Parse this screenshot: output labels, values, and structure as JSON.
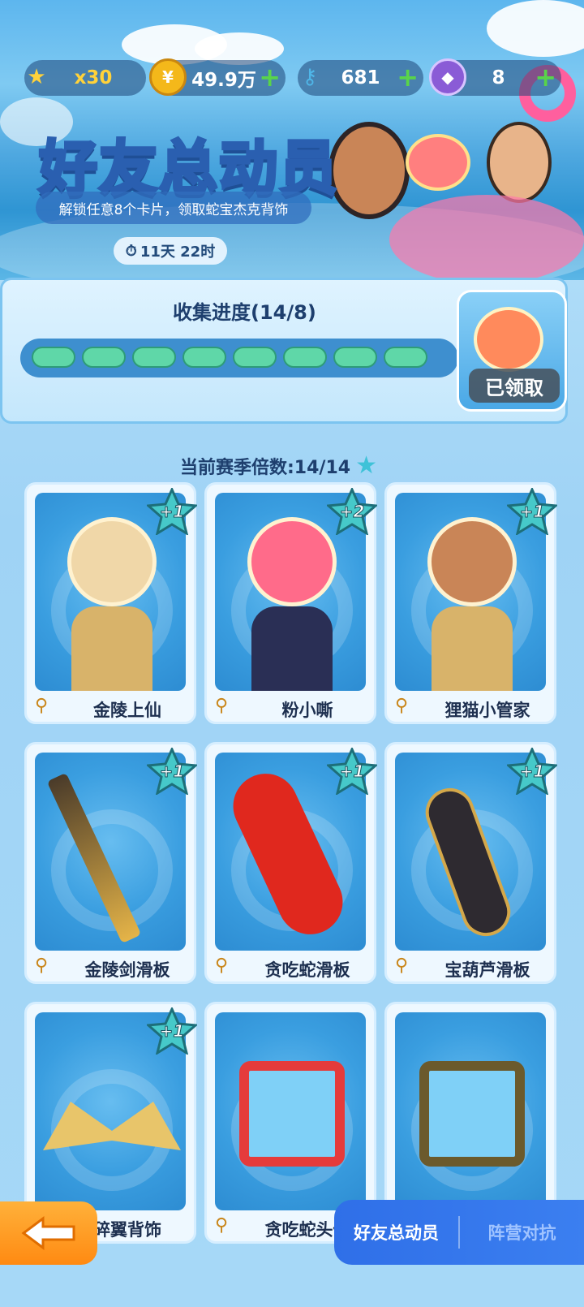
{
  "resources": {
    "stars": "x30",
    "coins": "49.9万",
    "keys": "681",
    "gems": "8"
  },
  "event": {
    "title": "好友总动员",
    "subtitle": "解锁任意8个卡片，领取蛇宝杰克背饰",
    "timer": "11天 22时"
  },
  "progress": {
    "title": "收集进度(14/8)",
    "filled": 8,
    "total": 8,
    "reward_status": "已领取"
  },
  "season_multiplier": "当前赛季倍数:14/14",
  "cards": [
    {
      "name": "金陵上仙",
      "badge": "+1",
      "art": "character-icon"
    },
    {
      "name": "粉小嘶",
      "badge": "+2",
      "art": "character-icon"
    },
    {
      "name": "狸猫小管家",
      "badge": "+1",
      "art": "character-icon"
    },
    {
      "name": "金陵剑滑板",
      "badge": "+1",
      "art": "sword-icon"
    },
    {
      "name": "贪吃蛇滑板",
      "badge": "+1",
      "art": "skateboard-icon"
    },
    {
      "name": "宝葫芦滑板",
      "badge": "+1",
      "art": "gourd-icon"
    },
    {
      "name": "碎翼背饰",
      "badge": "+1",
      "art": "wings-icon"
    },
    {
      "name": "贪吃蛇头像",
      "badge": "",
      "art": "frame-icon"
    },
    {
      "name": "",
      "badge": "",
      "art": "frame-icon"
    }
  ],
  "nav": {
    "tab_active": "好友总动员",
    "tab_other": "阵营对抗"
  },
  "colors": {
    "accent": "#2f6fe8",
    "progress_fill": "#5fd7a8",
    "back_button": "#ff8a12"
  }
}
